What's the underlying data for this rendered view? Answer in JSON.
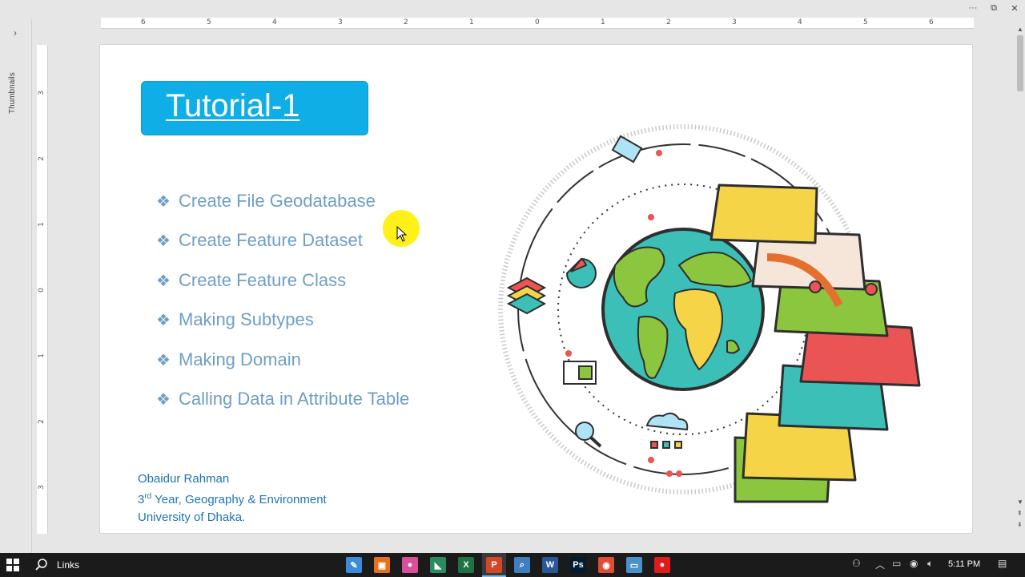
{
  "thumbnails": {
    "label": "Thumbnails",
    "toggle_glyph": "›"
  },
  "window": {
    "more": "···",
    "restore": "⧉",
    "close": "✕"
  },
  "ruler": {
    "h_labels": [
      "6",
      "5",
      "4",
      "3",
      "2",
      "1",
      "0",
      "1",
      "2",
      "3",
      "4",
      "5",
      "6"
    ],
    "v_labels": [
      "3",
      "2",
      "1",
      "0",
      "1",
      "2",
      "3"
    ]
  },
  "slide": {
    "title": "Tutorial-1",
    "bullet_glyph": "❖",
    "bullets": [
      "Create File Geodatabase",
      "Create Feature Dataset",
      "Create Feature Class",
      "Making Subtypes",
      "Making Domain",
      "Calling Data in Attribute Table"
    ],
    "author": {
      "name": "Obaidur Rahman",
      "year_num": "3",
      "year_sup": "rd",
      "year_rest": " Year, Geography & Environment",
      "university": "University of Dhaka."
    }
  },
  "taskbar": {
    "search_label": "Links",
    "clock": "5:11 PM",
    "apps": [
      {
        "name": "app-pen",
        "glyph": "✎",
        "color": "#3c8ad8"
      },
      {
        "name": "app-orange",
        "glyph": "▣",
        "color": "#e4711c"
      },
      {
        "name": "app-pink",
        "glyph": "●",
        "color": "#d94f9a"
      },
      {
        "name": "app-mapping",
        "glyph": "◣",
        "color": "#2a8c5e"
      },
      {
        "name": "app-excel",
        "glyph": "X",
        "color": "#1f7244"
      },
      {
        "name": "app-powerpoint",
        "glyph": "P",
        "color": "#d24726"
      },
      {
        "name": "app-magnifier",
        "glyph": "⌕",
        "color": "#3f7fbf"
      },
      {
        "name": "app-word",
        "glyph": "W",
        "color": "#2b579a"
      },
      {
        "name": "app-photoshop",
        "glyph": "Ps",
        "color": "#001d34"
      },
      {
        "name": "app-chrome",
        "glyph": "◉",
        "color": "#dd4b39"
      },
      {
        "name": "app-desktop",
        "glyph": "▭",
        "color": "#4a90c9"
      },
      {
        "name": "app-record",
        "glyph": "●",
        "color": "#e11b1b"
      }
    ]
  }
}
